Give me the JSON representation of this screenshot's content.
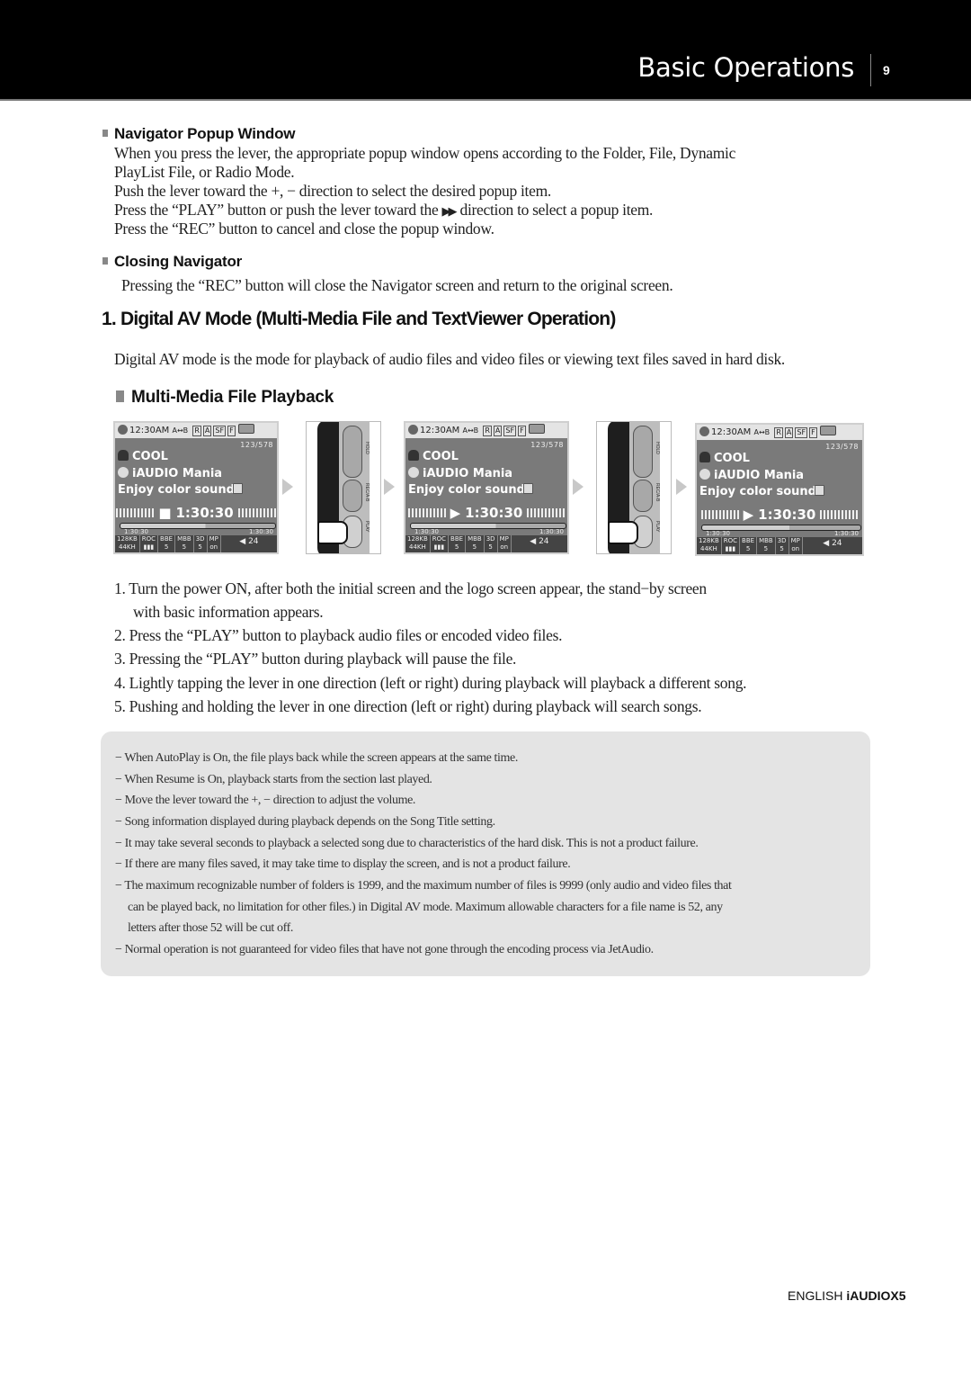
{
  "header": {
    "title": "Basic Operations",
    "page_number": "9"
  },
  "navigator_popup": {
    "heading": "Navigator Popup Window",
    "lines": [
      "When you press the lever, the appropriate popup window opens according to the Folder, File, Dynamic",
      "PlayList File, or Radio Mode.",
      "Push the lever toward the +, − direction to select the desired popup item."
    ],
    "play_line_before": "Press the  “PLAY”  button or push the lever toward the",
    "play_line_icon": "fast-forward-icon",
    "play_line_after": "direction to select a popup item.",
    "rec_line": "Press the  “REC”  button to cancel and close the popup window."
  },
  "closing_navigator": {
    "heading": "Closing Navigator",
    "text": "Pressing the  “REC”  button will close the Navigator screen and return to the original screen."
  },
  "section": {
    "heading": "1. Digital AV Mode (Multi-Media File and TextViewer Operation)",
    "intro": "Digital AV mode is the mode for playback of audio files and video files or viewing text files saved in hard disk."
  },
  "playback": {
    "heading": "Multi-Media File Playback",
    "screens": [
      {
        "clock": "12:30AM",
        "ab": "A↔B",
        "count": "123/578",
        "artist": "COOL",
        "album": "iAUDIO Mania",
        "title": "Enjoy color sound",
        "state_icon": "stop-icon",
        "state_glyph": "■",
        "time": "1:30:30",
        "elapsed": "1:30:30",
        "total": "1:30:30",
        "bitrate": "128KB",
        "samplerate": "44KH",
        "roc": "ROC",
        "bbe": "BBE",
        "bbe_val": "5",
        "mbb": "MBB",
        "mbb_val": "5",
        "d3": "3D",
        "d3_val": "5",
        "mp": "MP",
        "mp_val": "on",
        "volume": "24",
        "progress": 0.55
      },
      {
        "clock": "12:30AM",
        "ab": "A↔B",
        "count": "123/578",
        "artist": "COOL",
        "album": "iAUDIO Mania",
        "title": "Enjoy color sound",
        "state_icon": "play-icon",
        "state_glyph": "▶",
        "time": "1:30:30",
        "elapsed": "1:30:30",
        "total": "1:30:30",
        "bitrate": "128KB",
        "samplerate": "44KH",
        "roc": "ROC",
        "bbe": "BBE",
        "bbe_val": "5",
        "mbb": "MBB",
        "mbb_val": "5",
        "d3": "3D",
        "d3_val": "5",
        "mp": "MP",
        "mp_val": "on",
        "volume": "24",
        "progress": 0.55
      },
      {
        "clock": "12:30AM",
        "ab": "A↔B",
        "count": "123/578",
        "artist": "COOL",
        "album": "iAUDIO Mania",
        "title": "Enjoy color sound",
        "state_icon": "play-icon",
        "state_glyph": "▶",
        "time": "1:30:30",
        "elapsed": "1:30:30",
        "total": "1:30:30",
        "bitrate": "128KB",
        "samplerate": "44KH",
        "roc": "ROC",
        "bbe": "BBE",
        "bbe_val": "5",
        "mbb": "MBB",
        "mbb_val": "5",
        "d3": "3D",
        "d3_val": "5",
        "mp": "MP",
        "mp_val": "on",
        "volume": "24",
        "progress": 0.55
      }
    ],
    "device_buttons": [
      "HOLD",
      "REC/A-B",
      "PLAY"
    ],
    "steps": [
      "1. Turn the power ON, after both the initial screen and the logo screen appear, the stand−by screen",
      "with basic information appears.",
      "2. Press the  “PLAY”  button to playback audio files or encoded video files.",
      "3. Pressing the  “PLAY”  button during playback will pause the file.",
      "4. Lightly tapping the lever in one direction (left or right) during playback will playback a different song.",
      "5. Pushing and holding the lever in one direction (left or right) during playback will search songs."
    ]
  },
  "notes": [
    "− When AutoPlay is On, the file plays back while the screen appears at the same time.",
    "− When Resume is On, playback starts from the section last played.",
    "− Move the lever toward the +, − direction to adjust the volume.",
    "− Song information displayed during playback depends on the Song Title setting.",
    "− It may take several seconds to playback a selected song due to characteristics of the hard disk. This is not a product failure.",
    "− If there are many files saved, it may take time to display the screen, and is not a product failure.",
    "− The maximum recognizable number of folders is 1999, and the maximum number of files is 9999 (only audio and video files that",
    "can be played back, no limitation for other files.) in Digital AV mode. Maximum allowable characters for a file name is 52, any",
    "letters after those 52 will be cut off.",
    "− Normal operation is not guaranteed for video files that have not gone through the encoding process via JetAudio."
  ],
  "footer": {
    "language": "ENGLISH",
    "product": "iAUDIOX5"
  }
}
